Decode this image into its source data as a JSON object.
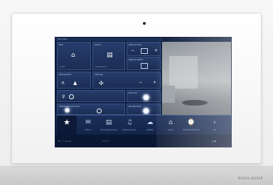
{
  "brand": "BUSCH-JAEGER",
  "screen": {
    "header_title": "Favoriten",
    "panels": {
      "licht": {
        "title": "Bad",
        "sub": "Licht",
        "value": ""
      },
      "szenen": {
        "title": "Szene",
        "sub": "Kinoabend"
      },
      "jalousie1": {
        "title": "Jalousie Süd",
        "minus": "−",
        "plus": "+"
      },
      "jalousie2": {
        "title": "Jalousie West"
      },
      "szenenlicht": {
        "title": "Szenenlicht"
      },
      "luftung": {
        "title": "Lüftung",
        "minus": "−",
        "plus": "+"
      },
      "dimmer1": {
        "title": "Dimmer"
      },
      "stehlampe": {
        "title": "Stehlampe Dimmer"
      },
      "dimmer2": {
        "title": "Deckenlicht"
      }
    },
    "nav": [
      {
        "icon": "star-icon",
        "glyph": "★",
        "label": ""
      },
      {
        "icon": "mail-icon",
        "glyph": "✉",
        "label": "Türruf"
      },
      {
        "icon": "calendar-icon",
        "glyph": "▤",
        "label": "Raumsteuerung"
      },
      {
        "icon": "music-icon",
        "glyph": "♫",
        "label": "Media Player"
      },
      {
        "icon": "weather-icon",
        "glyph": "☁",
        "label": "Wetter"
      },
      {
        "icon": "home-icon",
        "glyph": "⌂",
        "label": "Alarm"
      },
      {
        "icon": "clock-icon",
        "glyph": "⌚",
        "label": "Zeitschaltuhren"
      },
      {
        "icon": "more-icon",
        "glyph": "›",
        "label": "Mi"
      }
    ],
    "status": {
      "left": "Do. 1 Januar",
      "mid": "14:15",
      "right": "▲ ■"
    }
  }
}
